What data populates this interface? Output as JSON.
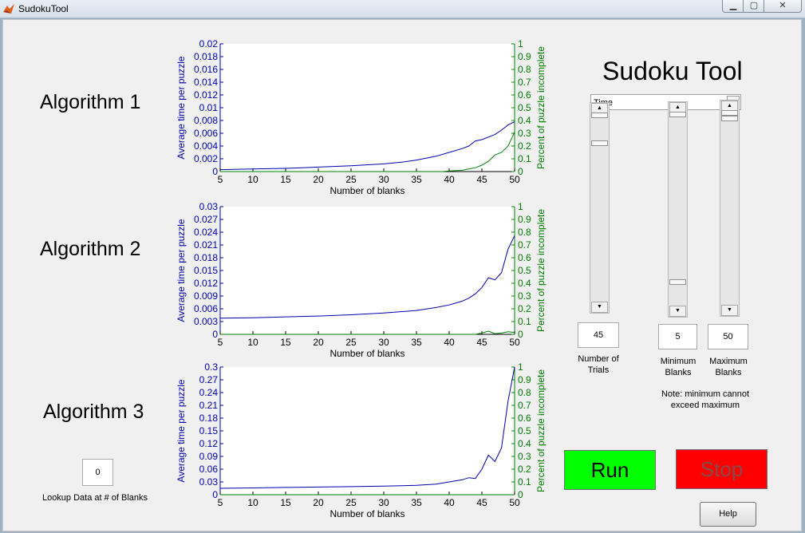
{
  "window": {
    "title": "SudokuTool",
    "min_glyph": "▁",
    "max_glyph": "▢",
    "close_glyph": "✕"
  },
  "app": {
    "title": "Sudoku Tool",
    "metric_select": {
      "value": "Time"
    },
    "trials": {
      "value": "45",
      "label_line1": "Number of",
      "label_line2": "Trials"
    },
    "min_blanks": {
      "value": "5",
      "label_line1": "Minimum",
      "label_line2": "Blanks"
    },
    "max_blanks": {
      "value": "50",
      "label_line1": "Maximum",
      "label_line2": "Blanks"
    },
    "note_line1": "Note:  minimum cannot",
    "note_line2": "exceed maximum",
    "run_label": "Run",
    "stop_label": "Stop",
    "help_label": "Help",
    "lookup": {
      "value": "0",
      "label": "Lookup Data at # of Blanks"
    },
    "algorithm_labels": [
      "Algorithm 1",
      "Algorithm 2",
      "Algorithm 3"
    ],
    "colors": {
      "time_axis": "#0000b0",
      "incomplete_axis": "#008000",
      "run": "#00ff00",
      "stop": "#ff0000"
    }
  },
  "chart_data": [
    {
      "type": "line",
      "xlabel": "Number of blanks",
      "ylabel": "Average time per puzzle",
      "y2label": "Percent of puzzle incomplete",
      "xlim": [
        5,
        50
      ],
      "xticks": [
        5,
        10,
        15,
        20,
        25,
        30,
        35,
        40,
        45,
        50
      ],
      "ylim": [
        0,
        0.02
      ],
      "yticks": [
        "0",
        "0.002",
        "0.004",
        "0.006",
        "0.008",
        "0.01",
        "0.012",
        "0.014",
        "0.016",
        "0.018",
        "0.02"
      ],
      "y2lim": [
        0,
        1
      ],
      "y2ticks": [
        "0",
        "0.1",
        "0.2",
        "0.3",
        "0.4",
        "0.5",
        "0.6",
        "0.7",
        "0.8",
        "0.9",
        "1"
      ],
      "series": [
        {
          "axis": "left",
          "color": "#0000b0",
          "x": [
            5,
            10,
            15,
            20,
            25,
            30,
            33,
            35,
            38,
            40,
            42,
            43,
            44,
            45,
            47,
            48,
            49,
            50
          ],
          "y": [
            0.0003,
            0.0004,
            0.0005,
            0.0007,
            0.0009,
            0.0012,
            0.0015,
            0.0018,
            0.0024,
            0.003,
            0.0036,
            0.004,
            0.0048,
            0.005,
            0.0058,
            0.0065,
            0.0073,
            0.0078
          ]
        },
        {
          "axis": "right",
          "color": "#008000",
          "x": [
            5,
            39,
            40,
            42,
            43,
            44,
            45,
            46,
            47,
            48,
            49,
            50
          ],
          "y": [
            0,
            0,
            0.005,
            0.01,
            0.02,
            0.03,
            0.05,
            0.08,
            0.13,
            0.15,
            0.2,
            0.31
          ]
        }
      ]
    },
    {
      "type": "line",
      "xlabel": "Number of blanks",
      "ylabel": "Average time per puzzle",
      "y2label": "Percent of puzzle incomplete",
      "xlim": [
        5,
        50
      ],
      "xticks": [
        5,
        10,
        15,
        20,
        25,
        30,
        35,
        40,
        45,
        50
      ],
      "ylim": [
        0,
        0.03
      ],
      "yticks": [
        "0",
        "0.003",
        "0.006",
        "0.009",
        "0.012",
        "0.015",
        "0.018",
        "0.021",
        "0.024",
        "0.027",
        "0.03"
      ],
      "y2lim": [
        0,
        1
      ],
      "y2ticks": [
        "0",
        "0.1",
        "0.2",
        "0.3",
        "0.4",
        "0.5",
        "0.6",
        "0.7",
        "0.8",
        "0.9",
        "1"
      ],
      "series": [
        {
          "axis": "left",
          "color": "#0000b0",
          "x": [
            5,
            10,
            15,
            20,
            25,
            30,
            35,
            38,
            40,
            42,
            43,
            44,
            45,
            46,
            47,
            48,
            49,
            50
          ],
          "y": [
            0.0038,
            0.0039,
            0.0041,
            0.0043,
            0.0046,
            0.005,
            0.0056,
            0.0063,
            0.0069,
            0.0078,
            0.0085,
            0.0095,
            0.011,
            0.0133,
            0.0128,
            0.0145,
            0.02,
            0.0232
          ]
        },
        {
          "axis": "right",
          "color": "#008000",
          "x": [
            5,
            44,
            45,
            46,
            47,
            48,
            49,
            50
          ],
          "y": [
            0,
            0,
            0.01,
            0.025,
            0.005,
            0.01,
            0.02,
            0.015
          ]
        }
      ]
    },
    {
      "type": "line",
      "xlabel": "Number of blanks",
      "ylabel": "Average time per puzzle",
      "y2label": "Percent of puzzle incomplete",
      "xlim": [
        5,
        50
      ],
      "xticks": [
        5,
        10,
        15,
        20,
        25,
        30,
        35,
        40,
        45,
        50
      ],
      "ylim": [
        0,
        0.3
      ],
      "yticks": [
        "0",
        "0.03",
        "0.06",
        "0.09",
        "0.12",
        "0.15",
        "0.18",
        "0.21",
        "0.24",
        "0.27",
        "0.3"
      ],
      "y2lim": [
        0,
        1
      ],
      "y2ticks": [
        "0",
        "0.1",
        "0.2",
        "0.3",
        "0.4",
        "0.5",
        "0.6",
        "0.7",
        "0.8",
        "0.9",
        "1"
      ],
      "series": [
        {
          "axis": "left",
          "color": "#0000b0",
          "x": [
            5,
            10,
            15,
            20,
            25,
            30,
            35,
            38,
            40,
            42,
            43,
            44,
            45,
            46,
            47,
            48,
            49,
            50
          ],
          "y": [
            0.015,
            0.016,
            0.017,
            0.018,
            0.019,
            0.02,
            0.022,
            0.025,
            0.03,
            0.035,
            0.04,
            0.038,
            0.06,
            0.093,
            0.078,
            0.11,
            0.22,
            0.3
          ]
        },
        {
          "axis": "right",
          "color": "#008000",
          "x": [
            5,
            50
          ],
          "y": [
            0,
            0
          ]
        }
      ]
    }
  ]
}
